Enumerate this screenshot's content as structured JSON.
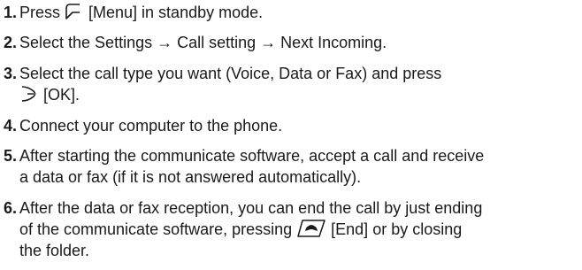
{
  "steps": [
    {
      "number": "1.",
      "lines": [
        {
          "pre": "Press ",
          "icon": "menu-softkey-icon",
          "post": " [Menu] in standby mode."
        }
      ]
    },
    {
      "number": "2.",
      "lines": [
        {
          "pre": "Select the Settings → Call setting → Next Incoming."
        }
      ]
    },
    {
      "number": "3.",
      "lines": [
        {
          "pre": "Select the call type you want (Voice, Data or Fax) and press"
        },
        {
          "icon": "ok-softkey-icon",
          "post": " [OK]."
        }
      ]
    },
    {
      "number": "4.",
      "lines": [
        {
          "pre": "Connect your computer to the phone."
        }
      ]
    },
    {
      "number": "5.",
      "lines": [
        {
          "pre": "After starting the communicate software, accept a call and receive"
        },
        {
          "pre": "a data or fax (if it is not answered automatically)."
        }
      ]
    },
    {
      "number": "6.",
      "lines": [
        {
          "pre": "After the data or fax reception, you can end the call by just ending"
        },
        {
          "pre": "of the communicate software, pressing ",
          "icon": "end-key-icon",
          "post": " [End] or by closing"
        },
        {
          "pre": "the folder."
        }
      ]
    }
  ]
}
